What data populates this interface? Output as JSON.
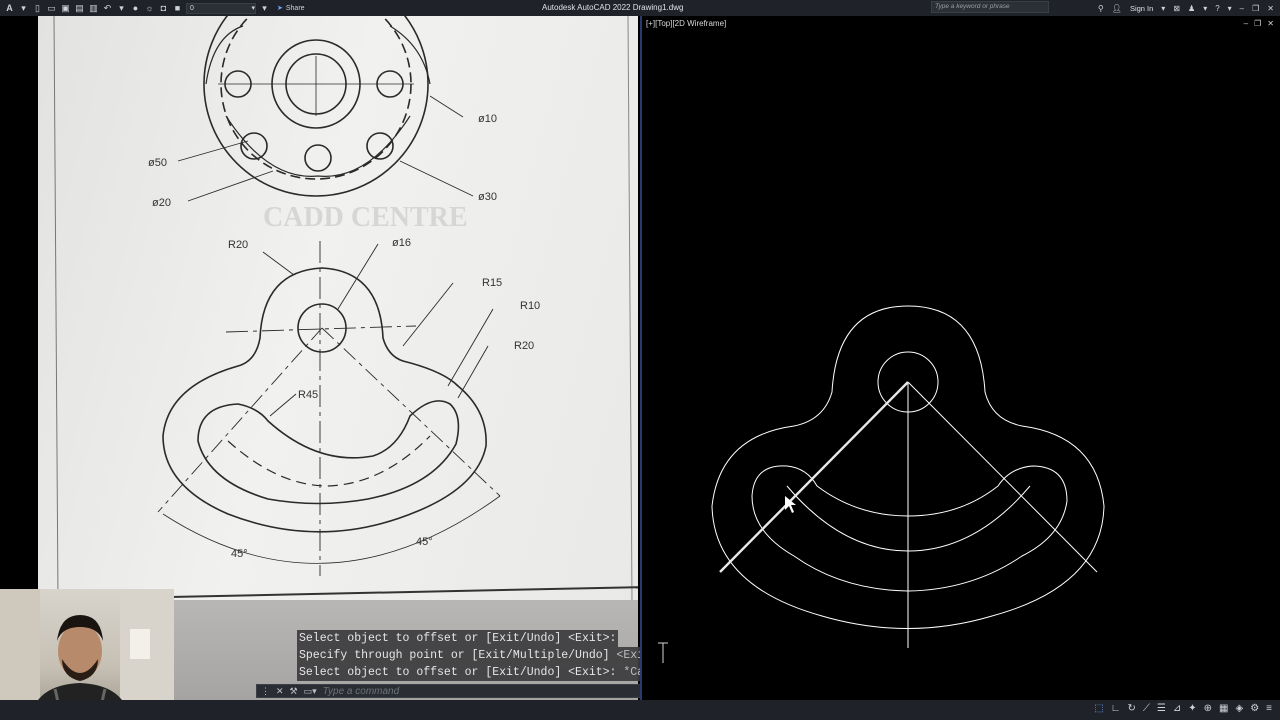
{
  "titlebar": {
    "layer_value": "0",
    "share_label": "Share",
    "app_title": "Autodesk AutoCAD 2022   Drawing1.dwg",
    "search_placeholder": "Type a keyword or phrase",
    "signin_label": "Sign In"
  },
  "viewport": {
    "label": "[+][Top][2D Wireframe]"
  },
  "paper": {
    "dims": {
      "d10": "ø10",
      "d50": "ø50",
      "d20": "ø20",
      "d30": "ø30",
      "r20a": "R20",
      "d16": "ø16",
      "r15": "R15",
      "r10": "R10",
      "r20b": "R20",
      "r45": "R45",
      "a45l": "45°",
      "a45r": "45°"
    },
    "watermark": "CADD CENTRE"
  },
  "command_history": [
    {
      "prompt": "Select object to offset or [Exit/Undo] <Exit>:",
      "tail": ""
    },
    {
      "prompt": "Specify through point or [Exit/Multiple/Undo] ",
      "tail": "<Exit>:"
    },
    {
      "prompt": "Select object to offset or [Exit/Undo] <Exit>:",
      "tail": " *Cancel*"
    }
  ],
  "command_input": {
    "placeholder": "Type a command"
  },
  "colors": {
    "title_bg": "#1f2228",
    "viewport_border": "#2a3a6a",
    "model_lines": "#ffffff"
  }
}
